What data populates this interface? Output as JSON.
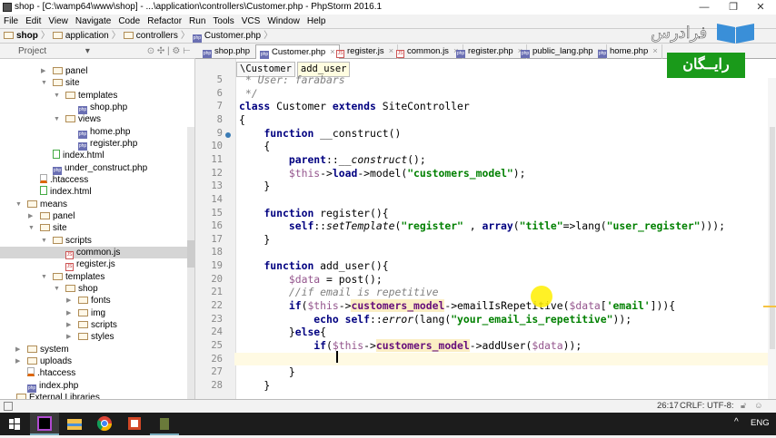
{
  "window": {
    "title": "shop - [C:\\wamp64\\www\\shop] - ...\\application\\controllers\\Customer.php - PhpStorm 2016.1",
    "minimize": "—",
    "restore": "❐",
    "close": "✕"
  },
  "menu": [
    "File",
    "Edit",
    "View",
    "Navigate",
    "Code",
    "Refactor",
    "Run",
    "Tools",
    "VCS",
    "Window",
    "Help"
  ],
  "navbar": [
    {
      "label": "shop",
      "icon": "folder"
    },
    {
      "label": "application",
      "icon": "folder"
    },
    {
      "label": "controllers",
      "icon": "folder"
    },
    {
      "label": "Customer.php",
      "icon": "php"
    }
  ],
  "project_panel": {
    "label": "Project",
    "dropdown": "▾",
    "tools": "⊙ ✣ | ⚙ ⊢"
  },
  "tabs": [
    {
      "label": "shop.php",
      "icon": "php"
    },
    {
      "label": "Customer.php",
      "icon": "php",
      "active": true
    },
    {
      "label": "register.js",
      "icon": "js"
    },
    {
      "label": "common.js",
      "icon": "js"
    },
    {
      "label": "register.php",
      "icon": "php"
    },
    {
      "label": "public_lang.php",
      "icon": "php"
    },
    {
      "label": "home.php",
      "icon": "php"
    }
  ],
  "tree": [
    {
      "label": "panel",
      "level": 2,
      "type": "folder",
      "arrow": "collapsed"
    },
    {
      "label": "site",
      "level": 2,
      "type": "folder",
      "arrow": "expanded"
    },
    {
      "label": "templates",
      "level": 3,
      "type": "folder",
      "arrow": "expanded"
    },
    {
      "label": "shop.php",
      "level": 4,
      "type": "php"
    },
    {
      "label": "views",
      "level": 3,
      "type": "folder",
      "arrow": "expanded"
    },
    {
      "label": "home.php",
      "level": 4,
      "type": "php"
    },
    {
      "label": "register.php",
      "level": 4,
      "type": "php"
    },
    {
      "label": "index.html",
      "level": 2,
      "type": "html"
    },
    {
      "label": "under_construct.php",
      "level": 2,
      "type": "php"
    },
    {
      "label": ".htaccess",
      "level": 1,
      "type": "ht"
    },
    {
      "label": "index.html",
      "level": 1,
      "type": "html"
    },
    {
      "label": "means",
      "level": 0,
      "type": "folder",
      "arrow": "expanded"
    },
    {
      "label": "panel",
      "level": 1,
      "type": "folder",
      "arrow": "collapsed"
    },
    {
      "label": "site",
      "level": 1,
      "type": "folder",
      "arrow": "expanded"
    },
    {
      "label": "scripts",
      "level": 2,
      "type": "folder",
      "arrow": "expanded"
    },
    {
      "label": "common.js",
      "level": 3,
      "type": "js",
      "selected": true
    },
    {
      "label": "register.js",
      "level": 3,
      "type": "js"
    },
    {
      "label": "templates",
      "level": 2,
      "type": "folder",
      "arrow": "expanded"
    },
    {
      "label": "shop",
      "level": 3,
      "type": "folder",
      "arrow": "expanded"
    },
    {
      "label": "fonts",
      "level": 4,
      "type": "folder",
      "arrow": "collapsed"
    },
    {
      "label": "img",
      "level": 4,
      "type": "folder",
      "arrow": "collapsed"
    },
    {
      "label": "scripts",
      "level": 4,
      "type": "folder",
      "arrow": "collapsed"
    },
    {
      "label": "styles",
      "level": 4,
      "type": "folder",
      "arrow": "collapsed"
    },
    {
      "label": "system",
      "level": 0,
      "type": "folder",
      "arrow": "collapsed"
    },
    {
      "label": "uploads",
      "level": 0,
      "type": "folder",
      "arrow": "collapsed"
    },
    {
      "label": ".htaccess",
      "level": 0,
      "type": "ht"
    },
    {
      "label": "index.php",
      "level": 0,
      "type": "php"
    },
    {
      "label": "External Libraries",
      "level": -1,
      "type": "lib"
    }
  ],
  "editor_breadcrumb": [
    "\\Customer",
    "add_user"
  ],
  "code": [
    {
      "n": "5",
      "t": [
        [
          "cm",
          " * User: farabars"
        ]
      ]
    },
    {
      "n": "6",
      "t": [
        [
          "cm",
          " */"
        ]
      ]
    },
    {
      "n": "7",
      "t": [
        [
          "kw",
          "class"
        ],
        [
          "",
          " Customer "
        ],
        [
          "kw",
          "extends"
        ],
        [
          "",
          " SiteController"
        ]
      ]
    },
    {
      "n": "8",
      "t": [
        [
          "",
          "{"
        ]
      ]
    },
    {
      "n": "9",
      "t": [
        [
          "",
          "    "
        ],
        [
          "kw",
          "function"
        ],
        [
          "",
          " __construct()"
        ]
      ]
    },
    {
      "n": "10",
      "t": [
        [
          "",
          "    {"
        ]
      ]
    },
    {
      "n": "11",
      "t": [
        [
          "",
          "        "
        ],
        [
          "kw",
          "parent"
        ],
        [
          "",
          "::"
        ],
        [
          "it",
          "__construct"
        ],
        [
          "",
          "();"
        ]
      ]
    },
    {
      "n": "12",
      "t": [
        [
          "",
          "        "
        ],
        [
          "vr",
          "$this"
        ],
        [
          "",
          "->"
        ],
        [
          "kw",
          "load"
        ],
        [
          "",
          "->model("
        ],
        [
          "st",
          "\"customers_model\""
        ],
        [
          "",
          ");"
        ]
      ]
    },
    {
      "n": "13",
      "t": [
        [
          "",
          "    }"
        ]
      ]
    },
    {
      "n": "14",
      "t": []
    },
    {
      "n": "15",
      "t": [
        [
          "",
          "    "
        ],
        [
          "kw",
          "function"
        ],
        [
          "",
          " register(){"
        ]
      ]
    },
    {
      "n": "16",
      "t": [
        [
          "",
          "        "
        ],
        [
          "kw",
          "self"
        ],
        [
          "",
          "::"
        ],
        [
          "it",
          "setTemplate"
        ],
        [
          "",
          "("
        ],
        [
          "st",
          "\"register\""
        ],
        [
          "",
          " , "
        ],
        [
          "kw",
          "array"
        ],
        [
          "",
          "("
        ],
        [
          "st",
          "\"title\""
        ],
        [
          "",
          "=>lang("
        ],
        [
          "st",
          "\"user_register\""
        ],
        [
          "",
          ")));"
        ]
      ]
    },
    {
      "n": "17",
      "t": [
        [
          "",
          "    }"
        ]
      ]
    },
    {
      "n": "18",
      "t": []
    },
    {
      "n": "19",
      "t": [
        [
          "",
          "    "
        ],
        [
          "kw",
          "function"
        ],
        [
          "",
          " add_user(){"
        ]
      ]
    },
    {
      "n": "20",
      "t": [
        [
          "",
          "        "
        ],
        [
          "vr",
          "$data"
        ],
        [
          "",
          " = post();"
        ]
      ]
    },
    {
      "n": "21",
      "t": [
        [
          "",
          "        "
        ],
        [
          "cm",
          "//if email is repetitive"
        ]
      ]
    },
    {
      "n": "22",
      "t": [
        [
          "",
          "        "
        ],
        [
          "kw",
          "if"
        ],
        [
          "",
          "("
        ],
        [
          "vr",
          "$this"
        ],
        [
          "",
          "->"
        ],
        [
          "fd",
          "customers_model"
        ],
        [
          "",
          "->emailIsRepetitive("
        ],
        [
          "vr",
          "$data"
        ],
        [
          "",
          "["
        ],
        [
          "st",
          "'email'"
        ],
        [
          "",
          "])){"
        ]
      ]
    },
    {
      "n": "23",
      "t": [
        [
          "",
          "            "
        ],
        [
          "kw",
          "echo self"
        ],
        [
          "",
          "::"
        ],
        [
          "it",
          "error"
        ],
        [
          "",
          "(lang("
        ],
        [
          "st",
          "\"your_email_is_repetitive\""
        ],
        [
          "",
          "));"
        ]
      ]
    },
    {
      "n": "24",
      "t": [
        [
          "",
          "        }"
        ],
        [
          "kw",
          "else"
        ],
        [
          "",
          "{"
        ]
      ]
    },
    {
      "n": "25",
      "t": [
        [
          "",
          "            "
        ],
        [
          "kw",
          "if"
        ],
        [
          "",
          "("
        ],
        [
          "vr",
          "$this"
        ],
        [
          "",
          "->"
        ],
        [
          "fd",
          "customers_model"
        ],
        [
          "",
          "->addUser("
        ],
        [
          "vr",
          "$data"
        ],
        [
          "",
          "));"
        ]
      ]
    },
    {
      "n": "26",
      "t": [],
      "current": true
    },
    {
      "n": "27",
      "t": [
        [
          "",
          "        }"
        ]
      ]
    },
    {
      "n": "28",
      "t": [
        [
          "",
          "    }"
        ]
      ]
    }
  ],
  "status": {
    "position": "26:17",
    "line_sep": "CRLF:",
    "encoding": "UTF-8:"
  },
  "taskbar": {
    "lang": "ENG",
    "tray": "^"
  },
  "watermark": {
    "logo_text": "فرادرس",
    "badge": "رایــگان"
  },
  "colors": {
    "keyword": "#000080",
    "string": "#008000",
    "comment": "#808080",
    "variable": "#94558d",
    "field": "#660e7a",
    "badge": "#1a9a1a"
  }
}
